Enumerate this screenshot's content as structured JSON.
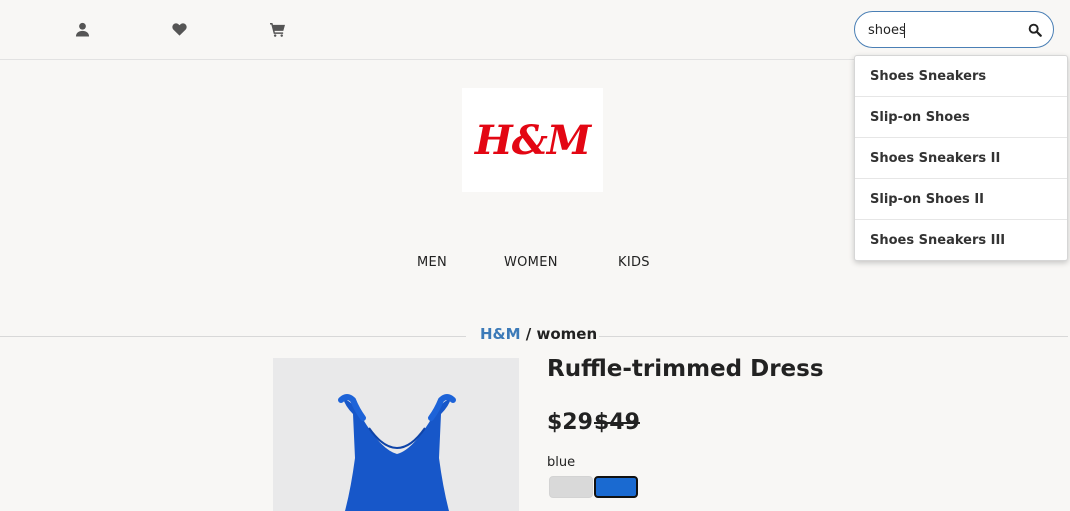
{
  "header": {
    "search": {
      "value": "shoes",
      "placeholder": ""
    },
    "suggestions": [
      {
        "label": "Shoes Sneakers"
      },
      {
        "label": "Slip-on Shoes"
      },
      {
        "label": "Shoes Sneakers II"
      },
      {
        "label": "Slip-on Shoes II"
      },
      {
        "label": "Shoes Sneakers III"
      }
    ]
  },
  "brand": {
    "logo_text": "H&M",
    "logo_color": "#e30613"
  },
  "nav": {
    "men": "MEN",
    "women": "WOMEN",
    "kids": "KIDS"
  },
  "breadcrumb": {
    "brand": "H&M",
    "separator": " / ",
    "category": "women"
  },
  "product": {
    "title": "Ruffle-trimmed Dress",
    "price": "$29",
    "old_price": "$49",
    "selected_color": "blue",
    "swatches": [
      {
        "name": "grey",
        "color": "#d9d9d9"
      },
      {
        "name": "blue",
        "color": "#1a6ad1"
      }
    ]
  }
}
